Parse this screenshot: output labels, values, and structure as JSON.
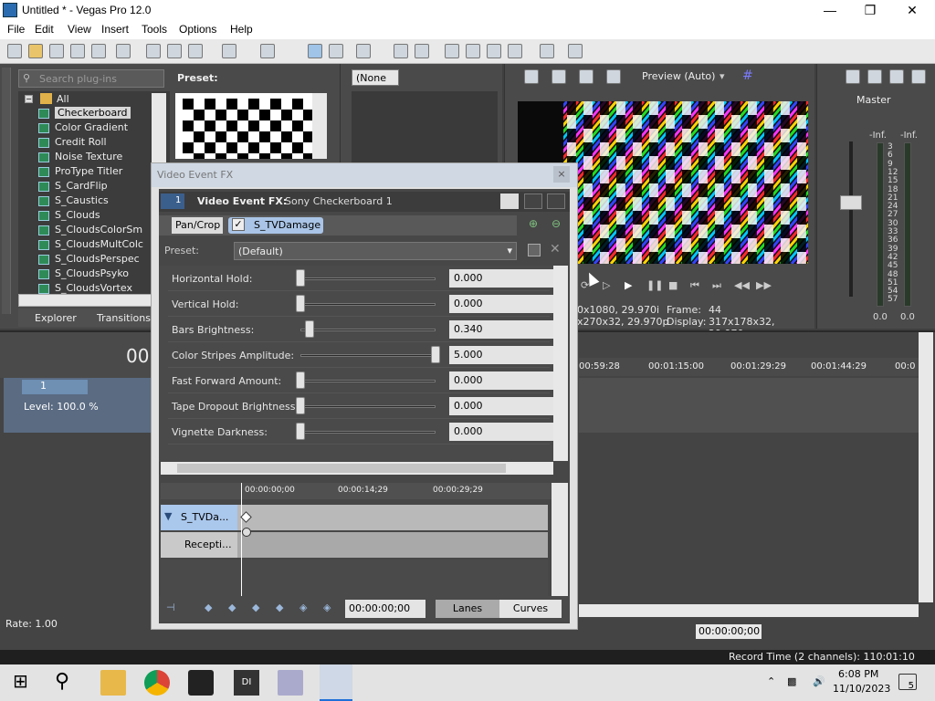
{
  "window": {
    "title": "Untitled * - Vegas Pro 12.0"
  },
  "menu": [
    "File",
    "Edit",
    "View",
    "Insert",
    "Tools",
    "Options",
    "Help"
  ],
  "plugins": {
    "search_placeholder": "Search plug-ins",
    "preset_label": "Preset:",
    "root": "All",
    "items": [
      "Checkerboard",
      "Color Gradient",
      "Credit Roll",
      "Noise Texture",
      "ProType Titler",
      "S_CardFlip",
      "S_Caustics",
      "S_Clouds",
      "S_CloudsColorSm",
      "S_CloudsMultColc",
      "S_CloudsPerspec",
      "S_CloudsPsyko",
      "S_CloudsVortex"
    ],
    "selected": "Checkerboard",
    "tabs": [
      "Explorer",
      "Transitions"
    ]
  },
  "mediabox": {
    "dropdown": "(None"
  },
  "preview": {
    "mode": "Preview (Auto)",
    "frame_label": "Frame:",
    "frame_value": "44",
    "project_info": "0x1080, 29.970i",
    "preview_info": "x270x32, 29.970p",
    "display_label": "Display:",
    "display_value": "317x178x32, 29.970"
  },
  "master": {
    "label": "Master",
    "meter_top_left": "-Inf.",
    "meter_top_right": "-Inf.",
    "scale": [
      "3",
      "6",
      "9",
      "12",
      "15",
      "18",
      "21",
      "24",
      "27",
      "30",
      "33",
      "36",
      "39",
      "42",
      "45",
      "48",
      "51",
      "54",
      "57"
    ],
    "bottom_left": "0.0",
    "bottom_right": "0.0"
  },
  "timeline": {
    "counter": "00",
    "ruler": [
      "00:59:28",
      "00:01:15:00",
      "00:01:29:29",
      "00:01:44:29",
      "00:0"
    ],
    "track_number": "1",
    "level": "Level: 100.0 %",
    "rate": "Rate: 1.00",
    "time_readout": "00:00:00;00",
    "record_time": "Record Time (2 channels): 110:01:10"
  },
  "dialog": {
    "title": "Video Event FX",
    "header_label": "Video Event FX:",
    "header_name": "Sony Checkerboard 1",
    "chain": [
      "Pan/Crop",
      "S_TVDamage"
    ],
    "preset_label": "Preset:",
    "preset_value": "(Default)",
    "params": [
      {
        "label": "Horizontal Hold:",
        "value": "0.000",
        "level": 0.0
      },
      {
        "label": "Vertical Hold:",
        "value": "0.000",
        "level": 0.0
      },
      {
        "label": "Bars Brightness:",
        "value": "0.340",
        "level": 0.07
      },
      {
        "label": "Color Stripes Amplitude:",
        "value": "5.000",
        "level": 1.0
      },
      {
        "label": "Fast Forward Amount:",
        "value": "0.000",
        "level": 0.0
      },
      {
        "label": "Tape Dropout Brightness:",
        "value": "0.000",
        "level": 0.0
      },
      {
        "label": "Vignette Darkness:",
        "value": "0.000",
        "level": 0.0
      }
    ],
    "keyframe_ruler": [
      "00:00:00;00",
      "00:00:14;29",
      "00:00:29;29"
    ],
    "lanes": [
      "S_TVDa...",
      "Recepti..."
    ],
    "timecode": "00:00:00;00",
    "lanes_button": "Lanes",
    "curves_button": "Curves"
  },
  "taskbar": {
    "time": "6:08 PM",
    "date": "11/10/2023",
    "notifications": "5"
  }
}
